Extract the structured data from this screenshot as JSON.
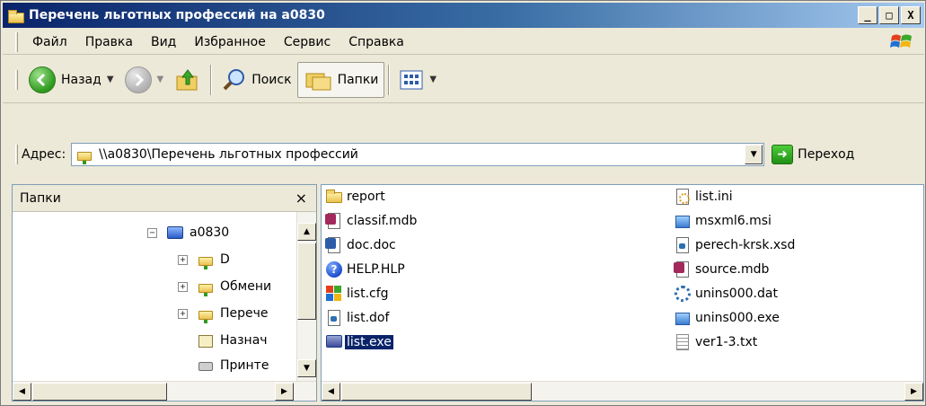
{
  "window": {
    "title": "Перечень льготных профессий на a0830",
    "controls": {
      "minimize": "_",
      "maximize": "□",
      "close": "X"
    }
  },
  "menu": {
    "items": [
      {
        "label": "Файл"
      },
      {
        "label": "Правка"
      },
      {
        "label": "Вид"
      },
      {
        "label": "Избранное"
      },
      {
        "label": "Сервис"
      },
      {
        "label": "Справка"
      }
    ]
  },
  "toolbar": {
    "back_label": "Назад",
    "search_label": "Поиск",
    "folders_label": "Папки"
  },
  "address": {
    "label": "Адрес:",
    "value": "\\\\a0830\\Перечень льготных профессий",
    "go_label": "Переход"
  },
  "folders_pane": {
    "title": "Папки",
    "close": "×",
    "tree": [
      {
        "label": "a0830",
        "expander": "−",
        "icon": "computer-icon"
      },
      {
        "label": "D",
        "expander": "+",
        "icon": "network-folder-icon"
      },
      {
        "label": "Обмени",
        "expander": "+",
        "icon": "network-folder-icon"
      },
      {
        "label": "Перече",
        "expander": "+",
        "icon": "network-folder-icon"
      },
      {
        "label": "Назнач",
        "expander": "",
        "icon": "scheduled-tasks-icon"
      },
      {
        "label": "Принте",
        "expander": "",
        "icon": "printers-icon"
      }
    ]
  },
  "files": {
    "left_column": [
      {
        "name": "report",
        "icon": "folder-icon"
      },
      {
        "name": "classif.mdb",
        "icon": "access-db-icon"
      },
      {
        "name": "doc.doc",
        "icon": "word-doc-icon"
      },
      {
        "name": "HELP.HLP",
        "icon": "help-file-icon"
      },
      {
        "name": "list.cfg",
        "icon": "config-file-icon"
      },
      {
        "name": "list.dof",
        "icon": "dof-file-icon"
      },
      {
        "name": "list.exe",
        "icon": "exe-icon",
        "selected": true
      }
    ],
    "right_column": [
      {
        "name": "list.ini",
        "icon": "ini-file-icon"
      },
      {
        "name": "msxml6.msi",
        "icon": "installer-icon"
      },
      {
        "name": "perech-krsk.xsd",
        "icon": "xsd-file-icon"
      },
      {
        "name": "source.mdb",
        "icon": "access-db-icon"
      },
      {
        "name": "unins000.dat",
        "icon": "dat-file-icon"
      },
      {
        "name": "unins000.exe",
        "icon": "installer-icon"
      },
      {
        "name": "ver1-3.txt",
        "icon": "text-file-icon"
      }
    ]
  },
  "colors": {
    "title_bar": "#0a246a",
    "selection": "#0a246a",
    "window_bg": "#ece9d8"
  }
}
